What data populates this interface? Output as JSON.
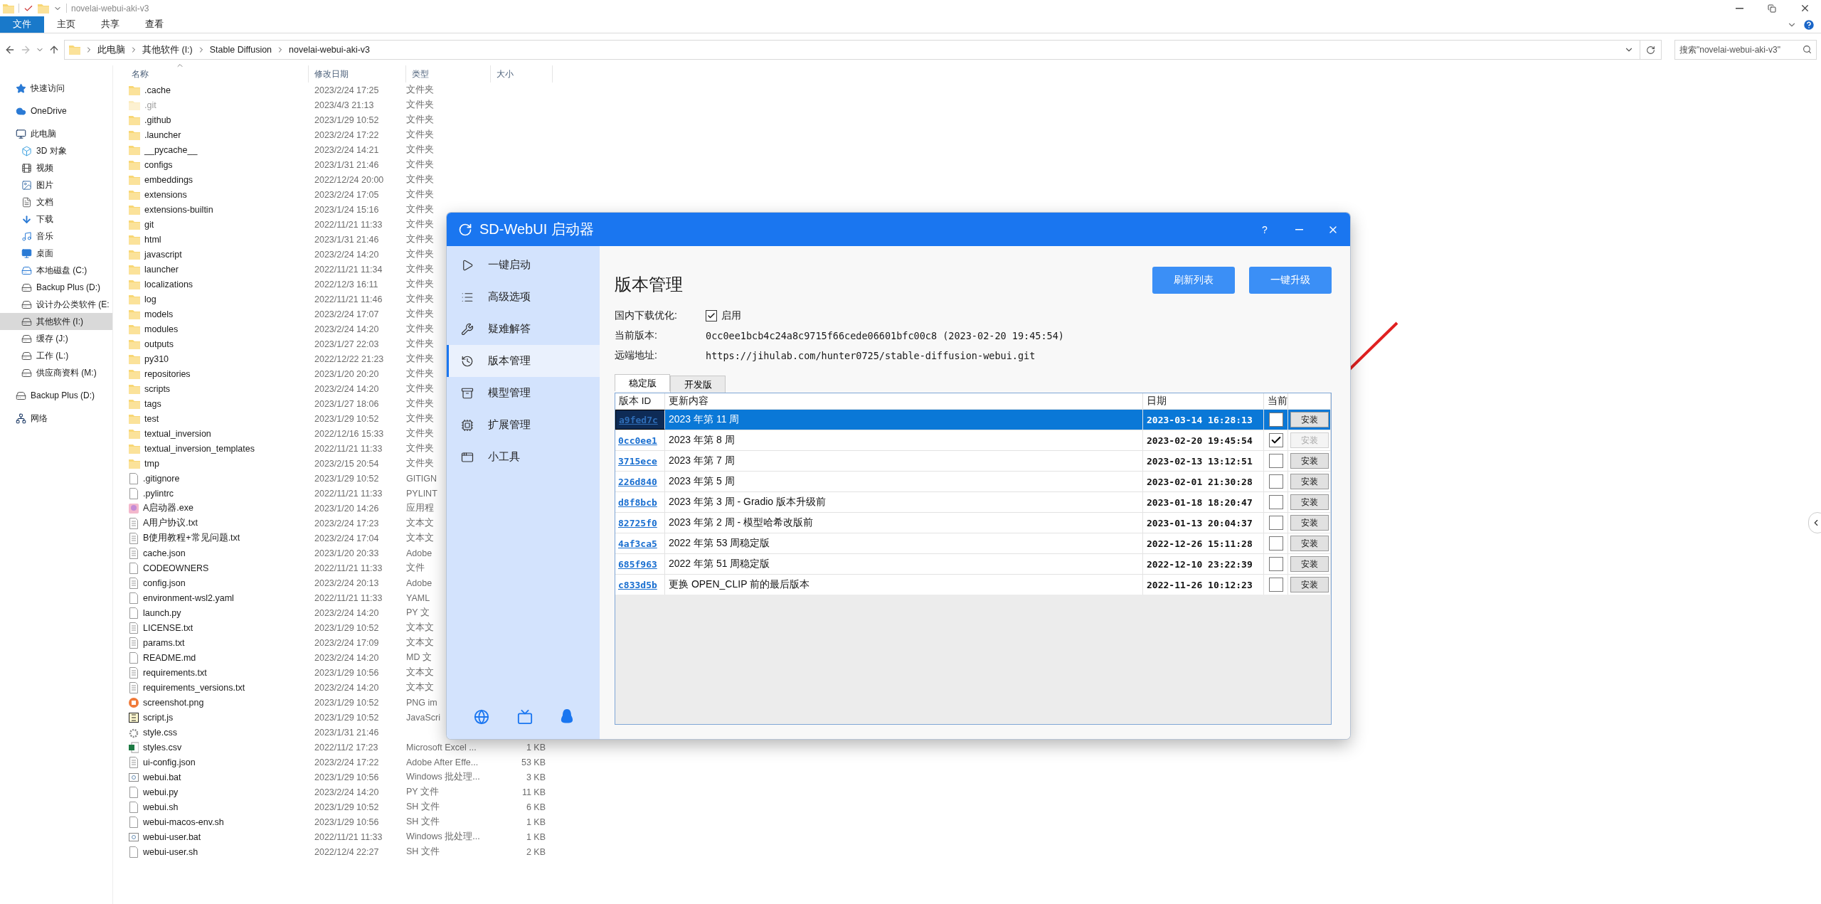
{
  "explorer": {
    "title": "novelai-webui-aki-v3",
    "ribbon_tabs": [
      {
        "label": "文件",
        "kind": "file"
      },
      {
        "label": "主页",
        "kind": "tab"
      },
      {
        "label": "共享",
        "kind": "tab"
      },
      {
        "label": "查看",
        "kind": "tab"
      }
    ],
    "path": [
      "此电脑",
      "其他软件 (I:)",
      "Stable Diffusion",
      "novelai-webui-aki-v3"
    ],
    "search": {
      "placeholder": "搜索\"novelai-webui-aki-v3\""
    },
    "columns": [
      "名称",
      "修改日期",
      "类型",
      "大小"
    ],
    "nav": [
      {
        "label": "快速访问",
        "kind": "star",
        "selected": false
      },
      {
        "label": "OneDrive",
        "kind": "cloud",
        "selected": false
      },
      {
        "label": "此电脑",
        "kind": "pc",
        "selected": false,
        "children": [
          {
            "label": "3D 对象",
            "kind": "cube",
            "selected": false
          },
          {
            "label": "视频",
            "kind": "video",
            "selected": false
          },
          {
            "label": "图片",
            "kind": "pictures",
            "selected": false
          },
          {
            "label": "文档",
            "kind": "document",
            "selected": false
          },
          {
            "label": "下载",
            "kind": "download",
            "selected": false
          },
          {
            "label": "音乐",
            "kind": "music",
            "selected": false
          },
          {
            "label": "桌面",
            "kind": "desktop",
            "selected": false
          },
          {
            "label": "本地磁盘 (C:)",
            "kind": "system-drive",
            "selected": false
          },
          {
            "label": "Backup Plus (D:)",
            "kind": "drive",
            "selected": false
          },
          {
            "label": "设计办公类软件 (E:",
            "kind": "drive",
            "selected": false
          },
          {
            "label": "其他软件 (I:)",
            "kind": "drive",
            "selected": true
          },
          {
            "label": "缓存 (J:)",
            "kind": "drive",
            "selected": false
          },
          {
            "label": "工作 (L:)",
            "kind": "drive",
            "selected": false
          },
          {
            "label": "供应商资料 (M:)",
            "kind": "drive",
            "selected": false
          }
        ]
      },
      {
        "label": "Backup Plus (D:)",
        "kind": "drive",
        "selected": false
      },
      {
        "label": "网络",
        "kind": "network",
        "selected": false
      }
    ],
    "files": [
      {
        "name": ".cache",
        "date": "2023/2/24 17:25",
        "type": "文件夹",
        "kind": "folder",
        "hidden": false
      },
      {
        "name": ".git",
        "date": "2023/4/3 21:13",
        "type": "文件夹",
        "kind": "folder",
        "hidden": true
      },
      {
        "name": ".github",
        "date": "2023/1/29 10:52",
        "type": "文件夹",
        "kind": "folder",
        "hidden": false
      },
      {
        "name": ".launcher",
        "date": "2023/2/24 17:22",
        "type": "文件夹",
        "kind": "folder",
        "hidden": false
      },
      {
        "name": "__pycache__",
        "date": "2023/2/24 14:21",
        "type": "文件夹",
        "kind": "folder",
        "hidden": false
      },
      {
        "name": "configs",
        "date": "2023/1/31 21:46",
        "type": "文件夹",
        "kind": "folder",
        "hidden": false
      },
      {
        "name": "embeddings",
        "date": "2022/12/24 20:00",
        "type": "文件夹",
        "kind": "folder",
        "hidden": false
      },
      {
        "name": "extensions",
        "date": "2023/2/24 17:05",
        "type": "文件夹",
        "kind": "folder",
        "hidden": false
      },
      {
        "name": "extensions-builtin",
        "date": "2023/1/24 15:16",
        "type": "文件夹",
        "kind": "folder",
        "hidden": false
      },
      {
        "name": "git",
        "date": "2022/11/21 11:33",
        "type": "文件夹",
        "kind": "folder",
        "hidden": false
      },
      {
        "name": "html",
        "date": "2023/1/31 21:46",
        "type": "文件夹",
        "kind": "folder",
        "hidden": false
      },
      {
        "name": "javascript",
        "date": "2023/2/24 14:20",
        "type": "文件夹",
        "kind": "folder",
        "hidden": false
      },
      {
        "name": "launcher",
        "date": "2022/11/21 11:34",
        "type": "文件夹",
        "kind": "folder",
        "hidden": false
      },
      {
        "name": "localizations",
        "date": "2022/12/3 16:11",
        "type": "文件夹",
        "kind": "folder",
        "hidden": false
      },
      {
        "name": "log",
        "date": "2022/11/21 11:46",
        "type": "文件夹",
        "kind": "folder",
        "hidden": false
      },
      {
        "name": "models",
        "date": "2023/2/24 17:07",
        "type": "文件夹",
        "kind": "folder",
        "hidden": false
      },
      {
        "name": "modules",
        "date": "2023/2/24 14:20",
        "type": "文件夹",
        "kind": "folder",
        "hidden": false
      },
      {
        "name": "outputs",
        "date": "2023/1/27 22:03",
        "type": "文件夹",
        "kind": "folder",
        "hidden": false
      },
      {
        "name": "py310",
        "date": "2022/12/22 21:23",
        "type": "文件夹",
        "kind": "folder",
        "hidden": false
      },
      {
        "name": "repositories",
        "date": "2023/1/20 20:20",
        "type": "文件夹",
        "kind": "folder",
        "hidden": false
      },
      {
        "name": "scripts",
        "date": "2023/2/24 14:20",
        "type": "文件夹",
        "kind": "folder",
        "hidden": false
      },
      {
        "name": "tags",
        "date": "2023/1/27 18:06",
        "type": "文件夹",
        "kind": "folder",
        "hidden": false
      },
      {
        "name": "test",
        "date": "2023/1/29 10:52",
        "type": "文件夹",
        "kind": "folder",
        "hidden": false
      },
      {
        "name": "textual_inversion",
        "date": "2022/12/16 15:33",
        "type": "文件夹",
        "kind": "folder",
        "hidden": false
      },
      {
        "name": "textual_inversion_templates",
        "date": "2022/11/21 11:33",
        "type": "文件夹",
        "kind": "folder",
        "hidden": false
      },
      {
        "name": "tmp",
        "date": "2023/2/15 20:54",
        "type": "文件夹",
        "kind": "folder",
        "hidden": false
      },
      {
        "name": ".gitignore",
        "date": "2023/1/29 10:52",
        "type": "GITIGN",
        "kind": "file",
        "hidden": false
      },
      {
        "name": ".pylintrc",
        "date": "2022/11/21 11:33",
        "type": "PYLINT",
        "kind": "file",
        "hidden": false
      },
      {
        "name": "A启动器.exe",
        "date": "2023/1/20 14:26",
        "type": "应用程",
        "kind": "exe",
        "hidden": false
      },
      {
        "name": "A用户协议.txt",
        "date": "2023/2/24 17:23",
        "type": "文本文",
        "kind": "text",
        "hidden": false
      },
      {
        "name": "B使用教程+常见问题.txt",
        "date": "2023/2/24 17:04",
        "type": "文本文",
        "kind": "text",
        "hidden": false
      },
      {
        "name": "cache.json",
        "date": "2023/1/20 20:33",
        "type": "Adobe",
        "kind": "json",
        "hidden": false
      },
      {
        "name": "CODEOWNERS",
        "date": "2022/11/21 11:33",
        "type": "文件",
        "kind": "file",
        "hidden": false
      },
      {
        "name": "config.json",
        "date": "2023/2/24 20:13",
        "type": "Adobe",
        "kind": "json",
        "hidden": false
      },
      {
        "name": "environment-wsl2.yaml",
        "date": "2022/11/21 11:33",
        "type": "YAML",
        "kind": "file",
        "hidden": false
      },
      {
        "name": "launch.py",
        "date": "2023/2/24 14:20",
        "type": "PY 文",
        "kind": "file",
        "hidden": false
      },
      {
        "name": "LICENSE.txt",
        "date": "2023/1/29 10:52",
        "type": "文本文",
        "kind": "text",
        "hidden": false
      },
      {
        "name": "params.txt",
        "date": "2023/2/24 17:09",
        "type": "文本文",
        "kind": "text",
        "hidden": false
      },
      {
        "name": "README.md",
        "date": "2023/2/24 14:20",
        "type": "MD 文",
        "kind": "file",
        "hidden": false
      },
      {
        "name": "requirements.txt",
        "date": "2023/1/29 10:56",
        "type": "文本文",
        "kind": "text",
        "hidden": false
      },
      {
        "name": "requirements_versions.txt",
        "date": "2023/2/24 14:20",
        "type": "文本文",
        "kind": "text",
        "hidden": false
      },
      {
        "name": "screenshot.png",
        "date": "2023/1/29 10:52",
        "type": "PNG im",
        "kind": "image",
        "hidden": false
      },
      {
        "name": "script.js",
        "date": "2023/1/29 10:52",
        "type": "JavaScri",
        "kind": "js",
        "hidden": false
      },
      {
        "name": "style.css",
        "date": "2023/1/31 21:46",
        "kind": "css",
        "hidden": false
      },
      {
        "name": "styles.csv",
        "date": "2022/11/2 17:23",
        "type": "Microsoft Excel ...",
        "size": "1 KB",
        "kind": "excel",
        "hidden": false
      },
      {
        "name": "ui-config.json",
        "date": "2023/2/24 17:22",
        "type": "Adobe After Effe...",
        "size": "53 KB",
        "kind": "json",
        "hidden": false
      },
      {
        "name": "webui.bat",
        "date": "2023/1/29 10:56",
        "type": "Windows 批处理...",
        "size": "3 KB",
        "kind": "bat",
        "hidden": false
      },
      {
        "name": "webui.py",
        "date": "2023/2/24 14:20",
        "type": "PY 文件",
        "size": "11 KB",
        "kind": "file",
        "hidden": false
      },
      {
        "name": "webui.sh",
        "date": "2023/1/29 10:52",
        "type": "SH 文件",
        "size": "6 KB",
        "kind": "file",
        "hidden": false
      },
      {
        "name": "webui-macos-env.sh",
        "date": "2023/1/29 10:56",
        "type": "SH 文件",
        "size": "1 KB",
        "kind": "file",
        "hidden": false
      },
      {
        "name": "webui-user.bat",
        "date": "2022/11/21 11:33",
        "type": "Windows 批处理...",
        "size": "1 KB",
        "kind": "bat",
        "hidden": false
      },
      {
        "name": "webui-user.sh",
        "date": "2022/12/4 22:27",
        "type": "SH 文件",
        "size": "2 KB",
        "kind": "file",
        "hidden": false
      }
    ]
  },
  "launcher": {
    "title": "SD-WebUI 启动器",
    "help": "?",
    "nav": [
      {
        "label": "一键启动",
        "kind": "play",
        "selected": false
      },
      {
        "label": "高级选项",
        "kind": "list",
        "selected": false
      },
      {
        "label": "疑难解答",
        "kind": "wrench",
        "selected": false
      },
      {
        "label": "版本管理",
        "kind": "history",
        "selected": true
      },
      {
        "label": "模型管理",
        "kind": "archive",
        "selected": false
      },
      {
        "label": "扩展管理",
        "kind": "chip",
        "selected": false
      },
      {
        "label": "小工具",
        "kind": "tools",
        "selected": false
      }
    ],
    "heading": "版本管理",
    "buttons": [
      "刷新列表",
      "一键升级"
    ],
    "mirror": {
      "label": "国内下载优化:",
      "option": "启用",
      "checked": true
    },
    "info": [
      {
        "label": "当前版本:",
        "value": "0cc0ee1bcb4c24a8c9715f66cede06601bfc00c8 (2023-02-20 19:45:54)"
      },
      {
        "label": "远端地址:",
        "value": "https://jihulab.com/hunter0725/stable-diffusion-webui.git"
      }
    ],
    "tabs": [
      {
        "label": "稳定版",
        "selected": true
      },
      {
        "label": "开发版",
        "selected": false
      }
    ],
    "columns": [
      "版本 ID",
      "更新内容",
      "日期",
      "当前"
    ],
    "versions": [
      {
        "id": "a9fed7c",
        "note": "2023 年第 11 周",
        "date": "2023-03-14 16:28:13",
        "current": false,
        "selected": true,
        "action": {
          "label": "安装",
          "disabled": false
        }
      },
      {
        "id": "0cc0ee1",
        "note": "2023 年第 8 周",
        "date": "2023-02-20 19:45:54",
        "current": true,
        "selected": false,
        "action": {
          "label": "安装",
          "disabled": true
        }
      },
      {
        "id": "3715ece",
        "note": "2023 年第 7 周",
        "date": "2023-02-13 13:12:51",
        "current": false,
        "selected": false,
        "action": {
          "label": "安装",
          "disabled": false
        }
      },
      {
        "id": "226d840",
        "note": "2023 年第 5 周",
        "date": "2023-02-01 21:30:28",
        "current": false,
        "selected": false,
        "action": {
          "label": "安装",
          "disabled": false
        }
      },
      {
        "id": "d8f8bcb",
        "note": "2023 年第 3 周 - Gradio 版本升级前",
        "date": "2023-01-18 18:20:47",
        "current": false,
        "selected": false,
        "action": {
          "label": "安装",
          "disabled": false
        }
      },
      {
        "id": "82725f0",
        "note": "2023 年第 2 周 - 模型哈希改版前",
        "date": "2023-01-13 20:04:37",
        "current": false,
        "selected": false,
        "action": {
          "label": "安装",
          "disabled": false
        }
      },
      {
        "id": "4af3ca5",
        "note": "2022 年第 53 周稳定版",
        "date": "2022-12-26 15:11:28",
        "current": false,
        "selected": false,
        "action": {
          "label": "安装",
          "disabled": false
        }
      },
      {
        "id": "685f963",
        "note": "2022 年第 51 周稳定版",
        "date": "2022-12-10 23:22:39",
        "current": false,
        "selected": false,
        "action": {
          "label": "安装",
          "disabled": false
        }
      },
      {
        "id": "c833d5b",
        "note": "更换 OPEN_CLIP 前的最后版本",
        "date": "2022-11-26 10:12:23",
        "current": false,
        "selected": false,
        "action": {
          "label": "安装",
          "disabled": false
        }
      }
    ]
  }
}
